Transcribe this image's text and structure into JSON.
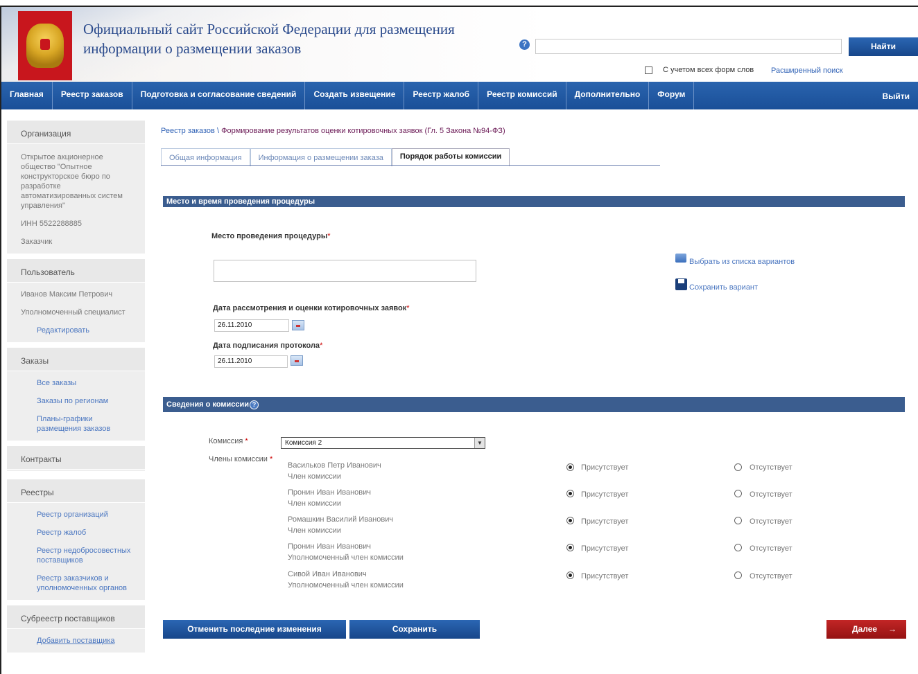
{
  "header": {
    "title": "Официальный сайт Российской Федерации для размещения информации о размещении заказов",
    "search_button": "Найти",
    "all_forms_label": "С учетом всех форм слов",
    "advanced_search": "Расширенный поиск"
  },
  "nav": {
    "items": [
      "Главная",
      "Реестр заказов",
      "Подготовка и согласование сведений",
      "Создать извещение",
      "Реестр жалоб",
      "Реестр комиссий",
      "Дополнительно",
      "Форум"
    ],
    "logout": "Выйти"
  },
  "sidebar": {
    "org_title": "Организация",
    "org_name": "Открытое акционерное общество \"Опытное конструкторское бюро по разработке автоматизированных систем управления\"",
    "org_inn": "ИНН 5522288885",
    "org_role": "Заказчик",
    "user_title": "Пользователь",
    "user_name": "Иванов Максим Петрович",
    "user_role": "Уполномоченный специалист",
    "user_edit": "Редактировать",
    "orders_title": "Заказы",
    "orders_links": [
      "Все заказы",
      "Заказы по регионам",
      "Планы-графики размещения заказов"
    ],
    "contracts_title": "Контракты",
    "registries_title": "Реестры",
    "registries_links": [
      "Реестр организаций",
      "Реестр жалоб",
      "Реестр недобросовестных поставщиков",
      "Реестр заказчиков и уполномоченных органов"
    ],
    "subregistry_title": "Субреестр поставщиков",
    "add_supplier": "Добавить поставщика"
  },
  "main": {
    "breadcrumb_root": "Реестр заказов",
    "breadcrumb_sep": "\\",
    "breadcrumb_current": "Формирование результатов оценки котировочных заявок (Гл. 5 Закона №94-ФЗ)",
    "tabs": [
      "Общая информация",
      "Информация о размещении заказа",
      "Порядок работы комиссии"
    ],
    "section_place": "Место и время проведения процедуры",
    "place_label": "Место проведения процедуры",
    "choose_link": "Выбрать из списка вариантов",
    "save_variant_link": "Сохранить вариант",
    "review_date_label": "Дата рассмотрения и оценки котировочных заявок",
    "review_date": "26.11.2010",
    "sign_date_label": "Дата подписания протокола",
    "sign_date": "26.11.2010",
    "section_commission": "Сведения о комиссии",
    "commission_label": "Комиссия",
    "commission_value": "Комиссия 2",
    "members_label": "Члены комиссии",
    "present_label": "Присутствует",
    "absent_label": "Отсутствует",
    "members": [
      {
        "name": "Васильков Петр Иванович",
        "role": "Член комиссии"
      },
      {
        "name": "Пронин Иван Иванович",
        "role": "Член комиссии"
      },
      {
        "name": "Ромашкин Василий Иванович",
        "role": "Член комиссии"
      },
      {
        "name": "Пронин Иван Иванович",
        "role": "Уполномоченный член комиссии"
      },
      {
        "name": "Сивой Иван Иванович",
        "role": "Уполномоченный член комиссии"
      }
    ],
    "btn_cancel": "Отменить последние изменения",
    "btn_save": "Сохранить",
    "btn_next": "Далее",
    "next_arrow": "→"
  }
}
